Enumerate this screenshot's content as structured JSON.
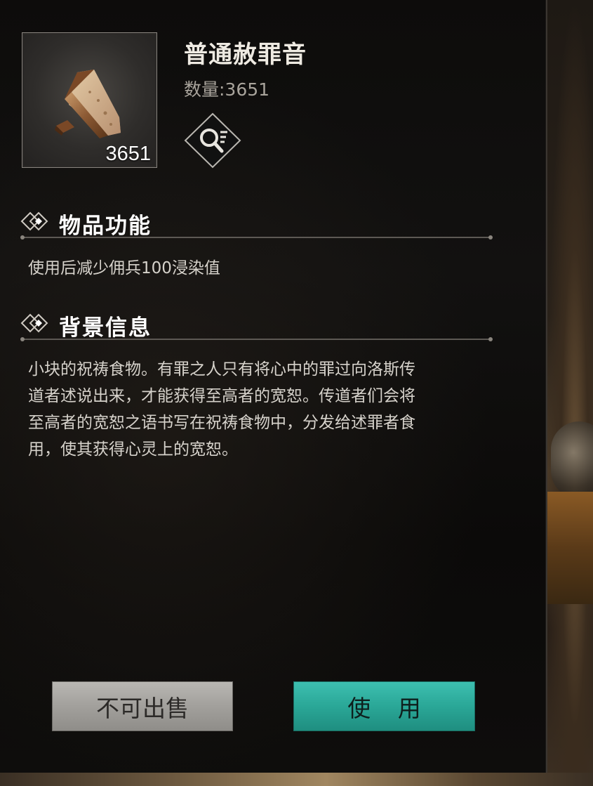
{
  "item": {
    "name": "普通赦罪音",
    "quantity_label": "数量:3651",
    "count_badge": "3651",
    "icon": "bread-wedge-icon"
  },
  "sections": [
    {
      "title": "物品功能",
      "text": "使用后减少佣兵100浸染值"
    },
    {
      "title": "背景信息",
      "lines": [
        "小块的祝祷食物。有罪之人只有将心中的罪过向洛斯传",
        "道者述说出来，才能获得至高者的宽恕。传道者们会将",
        "至高者的宽恕之语书写在祝祷食物中，分发给述罪者食",
        "用，使其获得心灵上的宽恕。"
      ]
    }
  ],
  "buttons": {
    "not_sellable": "不可出售",
    "use": "使 用"
  },
  "colors": {
    "use_button": "#2aa797",
    "sell_button": "#a4a29e",
    "panel_bg": "#0e0d0c"
  }
}
